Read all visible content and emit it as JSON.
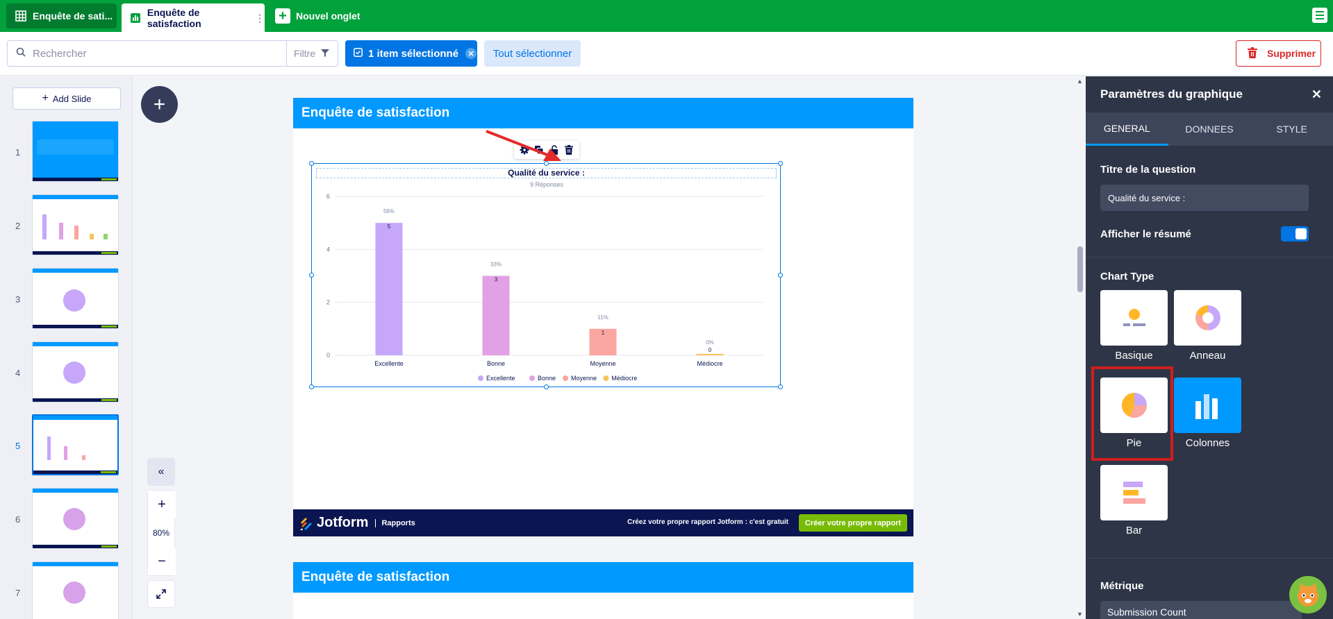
{
  "tabs": [
    {
      "label": "Enquête de sati..."
    },
    {
      "label": "Enquête de satisfaction"
    },
    {
      "label": "Nouvel onglet"
    }
  ],
  "toolbar": {
    "search_placeholder": "Rechercher",
    "filter_label": "Filtre",
    "selected_label": "1 item sélectionné",
    "select_all_label": "Tout sélectionner",
    "delete_label": "Supprimer"
  },
  "left": {
    "add_slide_label": "Add Slide",
    "slide_numbers": [
      "1",
      "2",
      "3",
      "4",
      "5",
      "6",
      "7"
    ],
    "selected_slide": 5
  },
  "zoom": {
    "value": "80%"
  },
  "slide": {
    "title": "Enquête de satisfaction",
    "footer_brand": "Jotform",
    "footer_section": "Rapports",
    "footer_text": "Créez votre propre rapport Jotform : c'est gratuit",
    "footer_button": "Créer votre propre rapport"
  },
  "slide2": {
    "title": "Enquête de satisfaction"
  },
  "chart_data": {
    "type": "bar",
    "title": "Qualité du service :",
    "subtitle": "9 Réponses",
    "categories": [
      "Excellente",
      "Bonne",
      "Moyenne",
      "Médiocre"
    ],
    "values": [
      5,
      3,
      1,
      0
    ],
    "percent_labels": [
      "56%",
      "33%",
      "11%",
      "0%"
    ],
    "colors": [
      "#c6a7fa",
      "#e2a0e5",
      "#fba6a1",
      "#f7c35a"
    ],
    "ylim": [
      0,
      6
    ],
    "yticks": [
      "0",
      "2",
      "4",
      "6"
    ],
    "grid": true,
    "legend_position": "bottom"
  },
  "panel": {
    "title": "Paramètres du graphique",
    "tabs": [
      "GENERAL",
      "DONNEES",
      "STYLE"
    ],
    "question_title_label": "Titre de la question",
    "question_title_value": "Qualité du service :",
    "summary_label": "Afficher le résumé",
    "chart_type_label": "Chart Type",
    "chart_types": [
      "Basique",
      "Anneau",
      "Pie",
      "Colonnes",
      "Bar"
    ],
    "active_chart_type": "Colonnes",
    "metric_label": "Métrique",
    "metric_value": "Submission Count"
  }
}
